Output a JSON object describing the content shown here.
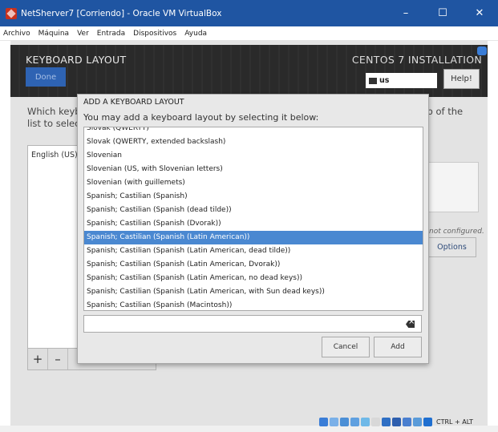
{
  "window": {
    "title": "NetSherver7 [Corriendo] - Oracle VM VirtualBox",
    "minimize": "–",
    "maximize": "☐",
    "close": "✕"
  },
  "menu": [
    "Archivo",
    "Máquina",
    "Ver",
    "Entrada",
    "Dispositivos",
    "Ayuda"
  ],
  "installer": {
    "screen_title": "KEYBOARD LAYOUT",
    "done_label": "Done",
    "product_title": "CENTOS 7 INSTALLATION",
    "keyboard_indicator": "us",
    "help_label": "Help!",
    "background_text_line1": "Which keyb",
    "background_text_line2": "list to select",
    "background_text_right": "top of the",
    "background_list_item": "English (US)",
    "add_symbol": "+",
    "remove_symbol": "–",
    "not_configured": "not configured.",
    "options_label": "Options"
  },
  "dialog": {
    "title": "ADD A KEYBOARD LAYOUT",
    "subtitle": "You may add a keyboard layout by selecting it below:",
    "layouts": [
      "Slovak (QWERTY)",
      "Slovak (QWERTY, extended backslash)",
      "Slovenian",
      "Slovenian (US, with Slovenian letters)",
      "Slovenian (with guillemets)",
      "Spanish; Castilian (Spanish)",
      "Spanish; Castilian (Spanish (dead tilde))",
      "Spanish; Castilian (Spanish (Dvorak))",
      "Spanish; Castilian (Spanish (Latin American))",
      "Spanish; Castilian (Spanish (Latin American, dead tilde))",
      "Spanish; Castilian (Spanish (Latin American, Dvorak))",
      "Spanish; Castilian (Spanish (Latin American, no dead keys))",
      "Spanish; Castilian (Spanish (Latin American, with Sun dead keys))",
      "Spanish; Castilian (Spanish (Macintosh))"
    ],
    "selected_index": 8,
    "search_value": "",
    "cancel_label": "Cancel",
    "add_label": "Add"
  },
  "statusbar": {
    "host_key": "CTRL + ALT"
  },
  "colors": {
    "titlebar": "#1f55a2",
    "selection": "#4a88d1",
    "done_button": "#2e63b3"
  }
}
